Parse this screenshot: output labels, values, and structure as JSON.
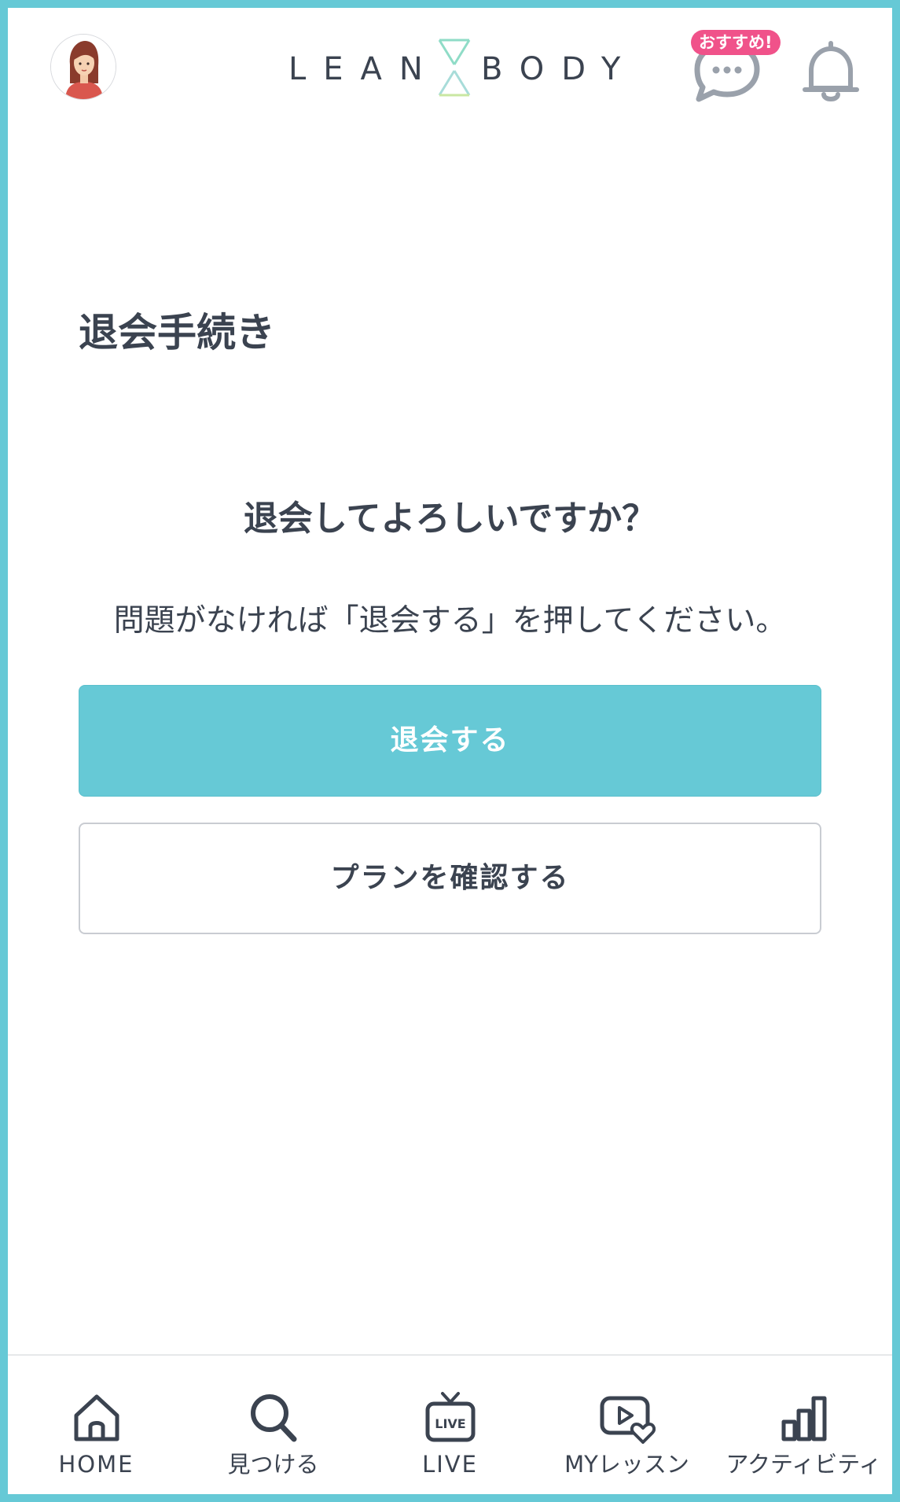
{
  "header": {
    "logo_left": "LEAN",
    "logo_right": "BODY",
    "chat_badge": "おすすめ!"
  },
  "main": {
    "page_title": "退会手続き",
    "question": "退会してよろしいですか？",
    "instruction": "問題がなければ「退会する」を押してください。",
    "primary_button": "退会する",
    "secondary_button": "プランを確認する"
  },
  "bottom_nav": {
    "items": [
      {
        "label": "HOME",
        "icon": "home-icon"
      },
      {
        "label": "見つける",
        "icon": "search-icon"
      },
      {
        "label": "LIVE",
        "icon": "live-tv-icon"
      },
      {
        "label": "MYレッスン",
        "icon": "my-lesson-icon"
      },
      {
        "label": "アクティビティ",
        "icon": "activity-chart-icon"
      }
    ]
  },
  "colors": {
    "accent": "#66c9d6",
    "text": "#3b4350",
    "badge": "#f0528a",
    "icon_gray": "#9aa1ab",
    "logo_mint": "#8fdcc7"
  }
}
